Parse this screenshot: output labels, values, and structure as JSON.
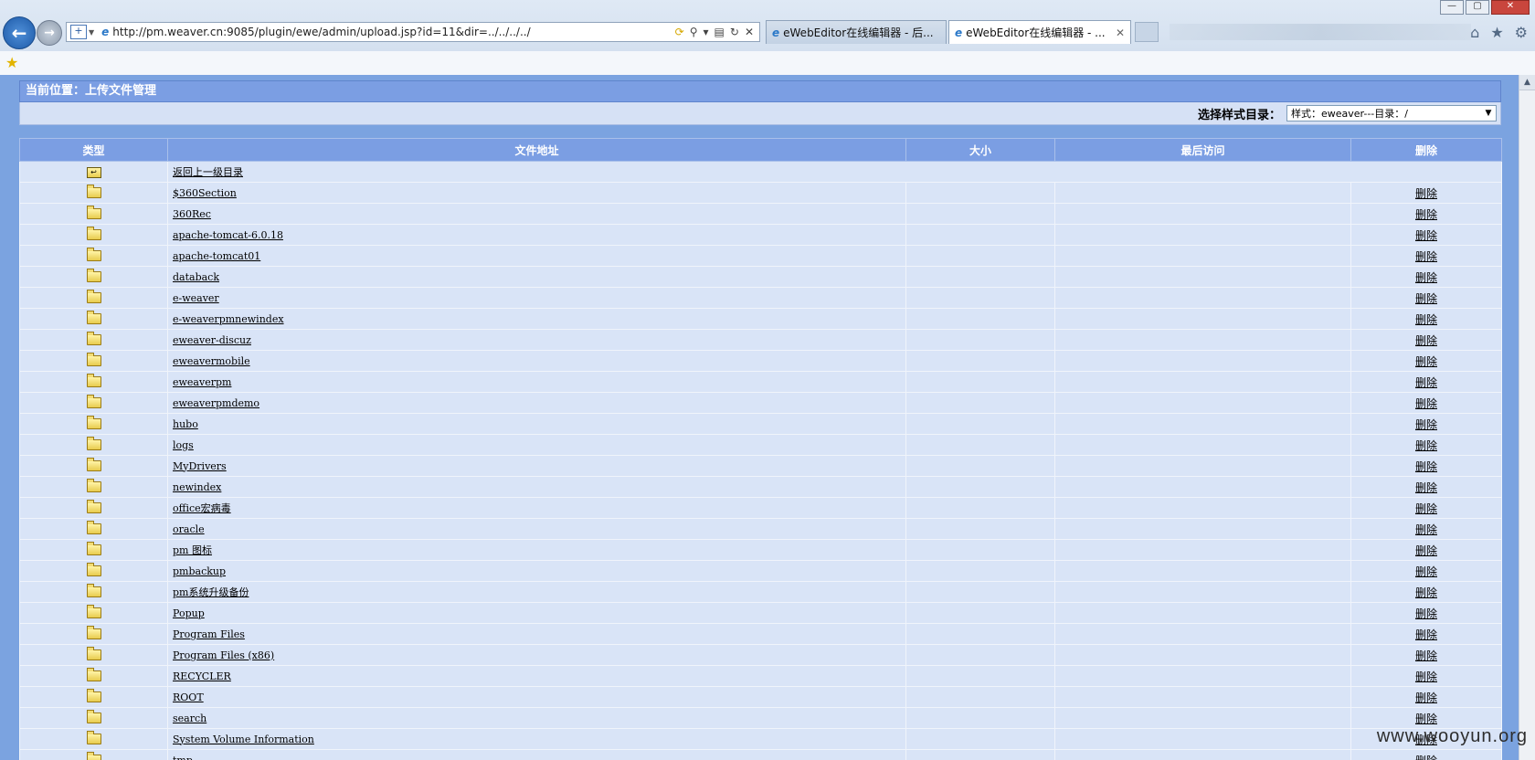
{
  "browser": {
    "address": "http://pm.weaver.cn:9085/plugin/ewe/admin/upload.jsp?id=11&dir=../../../../",
    "tabs": [
      {
        "label": "eWebEditor在线编辑器 - 后..."
      },
      {
        "label": "eWebEditor在线编辑器 - ..."
      }
    ],
    "window_buttons": {
      "minimize": "—",
      "maximize": "▢",
      "close": "✕"
    }
  },
  "page": {
    "location_label": "当前位置：上传文件管理",
    "style_dir_label": "选择样式目录：",
    "style_dir_value": "样式：eweaver---目录：/",
    "columns": [
      "类型",
      "文件地址",
      "大小",
      "最后访问",
      "删除"
    ],
    "parent_dir": "返回上一级目录",
    "delete_label": "删除",
    "folders": [
      "$360Section",
      "360Rec",
      "apache-tomcat-6.0.18",
      "apache-tomcat01",
      "databack",
      "e-weaver",
      "e-weaverpmnewindex",
      "eweaver-discuz",
      "eweavermobile",
      "eweaverpm",
      "eweaverpmdemo",
      "hubo",
      "logs",
      "MyDrivers",
      "newindex",
      "office宏病毒",
      "oracle",
      "pm 图标",
      "pmbackup",
      "pm系统升级备份",
      "Popup",
      "Program Files",
      "Program Files (x86)",
      "RECYCLER",
      "ROOT",
      "search",
      "System Volume Information",
      "tmp"
    ]
  },
  "watermark": "www.wooyun.org",
  "colors": {
    "header_blue": "#7b9ee3",
    "row_bg": "#d9e4f7",
    "page_bg": "#7ba3e0"
  }
}
